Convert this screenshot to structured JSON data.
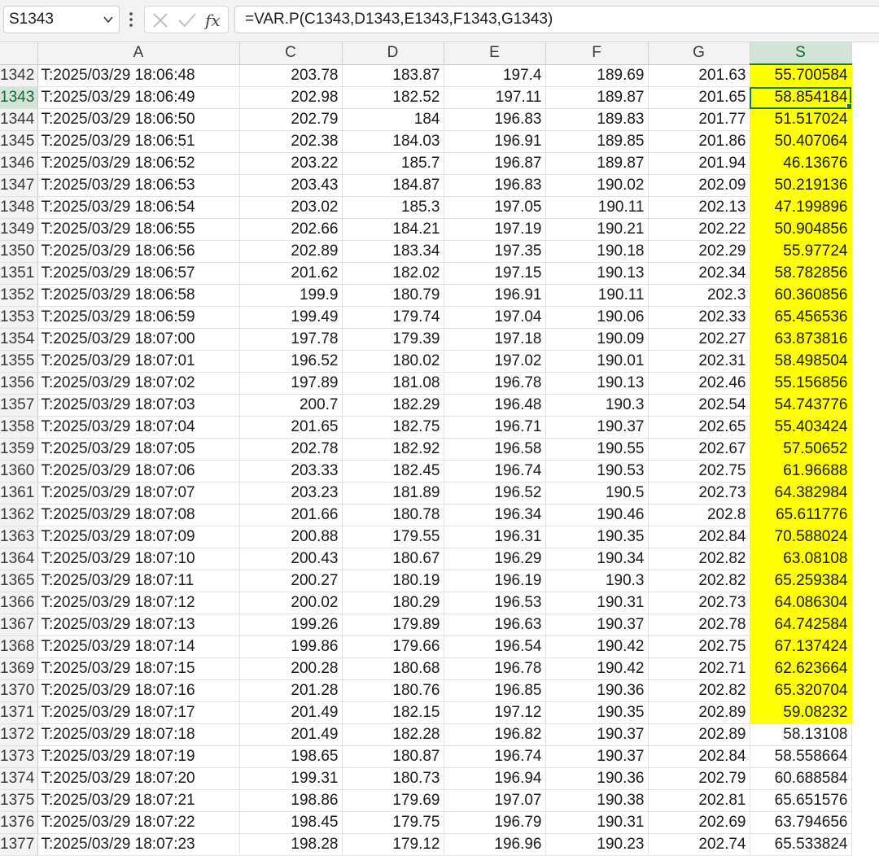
{
  "formula_bar": {
    "name_box": "S1343",
    "formula": "=VAR.P(C1343,D1343,E1343,F1343,G1343)",
    "icons": [
      "chevron-down-icon",
      "more-vertical-icon",
      "cancel-x-icon",
      "confirm-check-icon",
      "fx-function-icon"
    ]
  },
  "sheet": {
    "columns": [
      "A",
      "C",
      "D",
      "E",
      "F",
      "G",
      "S"
    ],
    "selected_column": "S",
    "active_cell": "S1343",
    "highlight_color": "#ffff00",
    "selection_color": "#107c41",
    "rows": [
      {
        "row": "1342",
        "a": "T:2025/03/29 18:06:48",
        "c": "203.78",
        "d": "183.87",
        "e": "197.4",
        "f": "189.69",
        "g": "201.63",
        "s": "55.700584",
        "hl": true
      },
      {
        "row": "1343",
        "a": "T:2025/03/29 18:06:49",
        "c": "202.98",
        "d": "182.52",
        "e": "197.11",
        "f": "189.87",
        "g": "201.65",
        "s": "58.854184",
        "hl": true
      },
      {
        "row": "1344",
        "a": "T:2025/03/29 18:06:50",
        "c": "202.79",
        "d": "184",
        "e": "196.83",
        "f": "189.83",
        "g": "201.77",
        "s": "51.517024",
        "hl": true
      },
      {
        "row": "1345",
        "a": "T:2025/03/29 18:06:51",
        "c": "202.38",
        "d": "184.03",
        "e": "196.91",
        "f": "189.85",
        "g": "201.86",
        "s": "50.407064",
        "hl": true
      },
      {
        "row": "1346",
        "a": "T:2025/03/29 18:06:52",
        "c": "203.22",
        "d": "185.7",
        "e": "196.87",
        "f": "189.87",
        "g": "201.94",
        "s": "46.13676",
        "hl": true
      },
      {
        "row": "1347",
        "a": "T:2025/03/29 18:06:53",
        "c": "203.43",
        "d": "184.87",
        "e": "196.83",
        "f": "190.02",
        "g": "202.09",
        "s": "50.219136",
        "hl": true
      },
      {
        "row": "1348",
        "a": "T:2025/03/29 18:06:54",
        "c": "203.02",
        "d": "185.3",
        "e": "197.05",
        "f": "190.11",
        "g": "202.13",
        "s": "47.199896",
        "hl": true
      },
      {
        "row": "1349",
        "a": "T:2025/03/29 18:06:55",
        "c": "202.66",
        "d": "184.21",
        "e": "197.19",
        "f": "190.21",
        "g": "202.22",
        "s": "50.904856",
        "hl": true
      },
      {
        "row": "1350",
        "a": "T:2025/03/29 18:06:56",
        "c": "202.89",
        "d": "183.34",
        "e": "197.35",
        "f": "190.18",
        "g": "202.29",
        "s": "55.97724",
        "hl": true
      },
      {
        "row": "1351",
        "a": "T:2025/03/29 18:06:57",
        "c": "201.62",
        "d": "182.02",
        "e": "197.15",
        "f": "190.13",
        "g": "202.34",
        "s": "58.782856",
        "hl": true
      },
      {
        "row": "1352",
        "a": "T:2025/03/29 18:06:58",
        "c": "199.9",
        "d": "180.79",
        "e": "196.91",
        "f": "190.11",
        "g": "202.3",
        "s": "60.360856",
        "hl": true
      },
      {
        "row": "1353",
        "a": "T:2025/03/29 18:06:59",
        "c": "199.49",
        "d": "179.74",
        "e": "197.04",
        "f": "190.06",
        "g": "202.33",
        "s": "65.456536",
        "hl": true
      },
      {
        "row": "1354",
        "a": "T:2025/03/29 18:07:00",
        "c": "197.78",
        "d": "179.39",
        "e": "197.18",
        "f": "190.09",
        "g": "202.27",
        "s": "63.873816",
        "hl": true
      },
      {
        "row": "1355",
        "a": "T:2025/03/29 18:07:01",
        "c": "196.52",
        "d": "180.02",
        "e": "197.02",
        "f": "190.01",
        "g": "202.31",
        "s": "58.498504",
        "hl": true
      },
      {
        "row": "1356",
        "a": "T:2025/03/29 18:07:02",
        "c": "197.89",
        "d": "181.08",
        "e": "196.78",
        "f": "190.13",
        "g": "202.46",
        "s": "55.156856",
        "hl": true
      },
      {
        "row": "1357",
        "a": "T:2025/03/29 18:07:03",
        "c": "200.7",
        "d": "182.29",
        "e": "196.48",
        "f": "190.3",
        "g": "202.54",
        "s": "54.743776",
        "hl": true
      },
      {
        "row": "1358",
        "a": "T:2025/03/29 18:07:04",
        "c": "201.65",
        "d": "182.75",
        "e": "196.71",
        "f": "190.37",
        "g": "202.65",
        "s": "55.403424",
        "hl": true
      },
      {
        "row": "1359",
        "a": "T:2025/03/29 18:07:05",
        "c": "202.78",
        "d": "182.92",
        "e": "196.58",
        "f": "190.55",
        "g": "202.67",
        "s": "57.50652",
        "hl": true
      },
      {
        "row": "1360",
        "a": "T:2025/03/29 18:07:06",
        "c": "203.33",
        "d": "182.45",
        "e": "196.74",
        "f": "190.53",
        "g": "202.75",
        "s": "61.96688",
        "hl": true
      },
      {
        "row": "1361",
        "a": "T:2025/03/29 18:07:07",
        "c": "203.23",
        "d": "181.89",
        "e": "196.52",
        "f": "190.5",
        "g": "202.73",
        "s": "64.382984",
        "hl": true
      },
      {
        "row": "1362",
        "a": "T:2025/03/29 18:07:08",
        "c": "201.66",
        "d": "180.78",
        "e": "196.34",
        "f": "190.46",
        "g": "202.8",
        "s": "65.611776",
        "hl": true
      },
      {
        "row": "1363",
        "a": "T:2025/03/29 18:07:09",
        "c": "200.88",
        "d": "179.55",
        "e": "196.31",
        "f": "190.35",
        "g": "202.84",
        "s": "70.588024",
        "hl": true
      },
      {
        "row": "1364",
        "a": "T:2025/03/29 18:07:10",
        "c": "200.43",
        "d": "180.67",
        "e": "196.29",
        "f": "190.34",
        "g": "202.82",
        "s": "63.08108",
        "hl": true
      },
      {
        "row": "1365",
        "a": "T:2025/03/29 18:07:11",
        "c": "200.27",
        "d": "180.19",
        "e": "196.19",
        "f": "190.3",
        "g": "202.82",
        "s": "65.259384",
        "hl": true
      },
      {
        "row": "1366",
        "a": "T:2025/03/29 18:07:12",
        "c": "200.02",
        "d": "180.29",
        "e": "196.53",
        "f": "190.31",
        "g": "202.73",
        "s": "64.086304",
        "hl": true
      },
      {
        "row": "1367",
        "a": "T:2025/03/29 18:07:13",
        "c": "199.26",
        "d": "179.89",
        "e": "196.63",
        "f": "190.37",
        "g": "202.78",
        "s": "64.742584",
        "hl": true
      },
      {
        "row": "1368",
        "a": "T:2025/03/29 18:07:14",
        "c": "199.86",
        "d": "179.66",
        "e": "196.54",
        "f": "190.42",
        "g": "202.75",
        "s": "67.137424",
        "hl": true
      },
      {
        "row": "1369",
        "a": "T:2025/03/29 18:07:15",
        "c": "200.28",
        "d": "180.68",
        "e": "196.78",
        "f": "190.42",
        "g": "202.71",
        "s": "62.623664",
        "hl": true
      },
      {
        "row": "1370",
        "a": "T:2025/03/29 18:07:16",
        "c": "201.28",
        "d": "180.76",
        "e": "196.85",
        "f": "190.36",
        "g": "202.82",
        "s": "65.320704",
        "hl": true
      },
      {
        "row": "1371",
        "a": "T:2025/03/29 18:07:17",
        "c": "201.49",
        "d": "182.15",
        "e": "197.12",
        "f": "190.35",
        "g": "202.89",
        "s": "59.08232",
        "hl": true
      },
      {
        "row": "1372",
        "a": "T:2025/03/29 18:07:18",
        "c": "201.49",
        "d": "182.28",
        "e": "196.82",
        "f": "190.37",
        "g": "202.89",
        "s": "58.13108",
        "hl": false
      },
      {
        "row": "1373",
        "a": "T:2025/03/29 18:07:19",
        "c": "198.65",
        "d": "180.87",
        "e": "196.74",
        "f": "190.37",
        "g": "202.84",
        "s": "58.558664",
        "hl": false
      },
      {
        "row": "1374",
        "a": "T:2025/03/29 18:07:20",
        "c": "199.31",
        "d": "180.73",
        "e": "196.94",
        "f": "190.36",
        "g": "202.79",
        "s": "60.688584",
        "hl": false
      },
      {
        "row": "1375",
        "a": "T:2025/03/29 18:07:21",
        "c": "198.86",
        "d": "179.69",
        "e": "197.07",
        "f": "190.38",
        "g": "202.81",
        "s": "65.651576",
        "hl": false
      },
      {
        "row": "1376",
        "a": "T:2025/03/29 18:07:22",
        "c": "198.45",
        "d": "179.75",
        "e": "196.79",
        "f": "190.31",
        "g": "202.69",
        "s": "63.794656",
        "hl": false
      },
      {
        "row": "1377",
        "a": "T:2025/03/29 18:07:23",
        "c": "198.28",
        "d": "179.12",
        "e": "196.96",
        "f": "190.23",
        "g": "202.74",
        "s": "65.533824",
        "hl": false
      }
    ]
  }
}
